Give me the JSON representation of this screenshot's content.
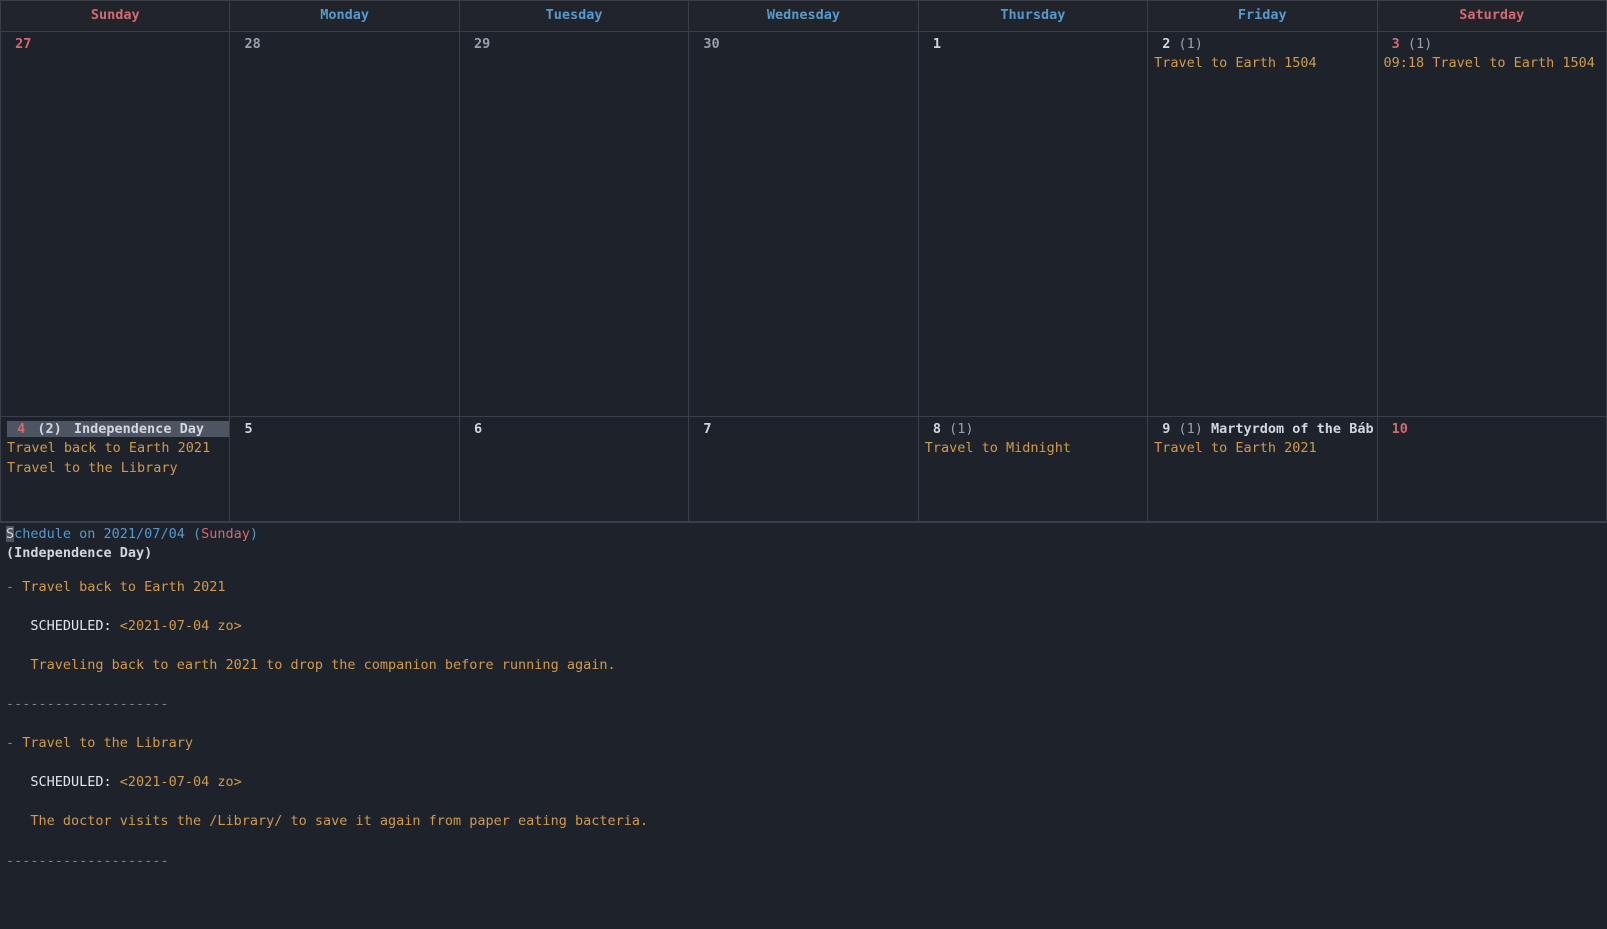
{
  "dayHeaders": [
    {
      "label": "Sunday",
      "weekend": true
    },
    {
      "label": "Monday",
      "weekend": false
    },
    {
      "label": "Tuesday",
      "weekend": false
    },
    {
      "label": "Wednesday",
      "weekend": false
    },
    {
      "label": "Thursday",
      "weekend": false
    },
    {
      "label": "Friday",
      "weekend": false
    },
    {
      "label": "Saturday",
      "weekend": true
    }
  ],
  "weeks": [
    {
      "tall": true,
      "days": [
        {
          "num": "27",
          "weekend": true,
          "dim": false,
          "count": "",
          "holiday": "",
          "events": [],
          "selected": false
        },
        {
          "num": "28",
          "weekend": false,
          "dim": true,
          "count": "",
          "holiday": "",
          "events": [],
          "selected": false
        },
        {
          "num": "29",
          "weekend": false,
          "dim": true,
          "count": "",
          "holiday": "",
          "events": [],
          "selected": false
        },
        {
          "num": "30",
          "weekend": false,
          "dim": true,
          "count": "",
          "holiday": "",
          "events": [],
          "selected": false
        },
        {
          "num": "1",
          "weekend": false,
          "dim": false,
          "count": "",
          "holiday": "",
          "events": [],
          "selected": false
        },
        {
          "num": "2",
          "weekend": false,
          "dim": false,
          "count": "(1)",
          "holiday": "",
          "events": [
            "Travel to Earth 1504"
          ],
          "selected": false
        },
        {
          "num": "3",
          "weekend": true,
          "dim": false,
          "count": "(1)",
          "holiday": "",
          "events": [
            "09:18 Travel to Earth 1504"
          ],
          "selected": false
        }
      ]
    },
    {
      "tall": false,
      "days": [
        {
          "num": "4",
          "weekend": true,
          "dim": false,
          "count": "(2)",
          "holiday": "Independence Day",
          "events": [
            "Travel back to Earth 2021",
            "Travel to the Library"
          ],
          "selected": true
        },
        {
          "num": "5",
          "weekend": false,
          "dim": false,
          "count": "",
          "holiday": "",
          "events": [],
          "selected": false
        },
        {
          "num": "6",
          "weekend": false,
          "dim": false,
          "count": "",
          "holiday": "",
          "events": [],
          "selected": false
        },
        {
          "num": "7",
          "weekend": false,
          "dim": false,
          "count": "",
          "holiday": "",
          "events": [],
          "selected": false
        },
        {
          "num": "8",
          "weekend": false,
          "dim": false,
          "count": "(1)",
          "holiday": "",
          "events": [
            "Travel to Midnight"
          ],
          "selected": false
        },
        {
          "num": "9",
          "weekend": false,
          "dim": false,
          "count": "(1)",
          "holiday": "Martyrdom of the Báb",
          "events": [
            "Travel to Earth 2021"
          ],
          "selected": false
        },
        {
          "num": "10",
          "weekend": true,
          "dim": false,
          "count": "",
          "holiday": "",
          "events": [],
          "selected": false
        }
      ]
    }
  ],
  "schedule": {
    "title_s": "S",
    "title_pre": "chedule on 2021/07/04 (",
    "title_day": "Sunday",
    "title_post": ")",
    "holiday": "(Independence Day)",
    "sep": "--------------------",
    "items": [
      {
        "bullet": "- ",
        "title": "Travel back to Earth 2021",
        "sched_label": "SCHEDULED: ",
        "sched_ts": "<2021-07-04 zo>",
        "body": "Traveling back to earth 2021 to drop the companion before running again."
      },
      {
        "bullet": "- ",
        "title": "Travel to the Library",
        "sched_label": "SCHEDULED: ",
        "sched_ts": "<2021-07-04 zo>",
        "body": "The doctor visits the /Library/ to save it again from paper eating bacteria."
      }
    ]
  }
}
